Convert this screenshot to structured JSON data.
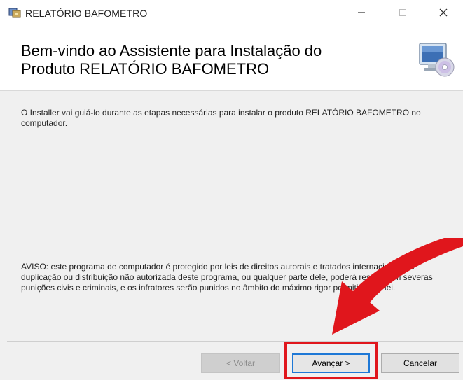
{
  "window": {
    "title": "RELATÓRIO BAFOMETRO",
    "minimize_glyph": "—",
    "maximize_glyph": "□",
    "close_glyph": "✕"
  },
  "header": {
    "title_line1": "Bem-vindo ao Assistente para Instalação do",
    "title_line2": "Produto RELATÓRIO BAFOMETRO",
    "icon": "computer-cd-icon"
  },
  "body": {
    "intro": "O Installer vai guiá-lo durante as etapas necessárias para instalar o produto RELATÓRIO BAFOMETRO no computador.",
    "warning": "AVISO: este programa de computador é protegido por leis de direitos autorais e tratados internacionais. A duplicação ou distribuição não autorizada deste programa, ou qualquer parte dele, poderá resultar em severas punições civis e criminais, e os infratores serão punidos no âmbito do máximo rigor permitido por lei."
  },
  "buttons": {
    "back": "< Voltar",
    "next": "Avançar >",
    "cancel": "Cancelar"
  },
  "annotation": {
    "arrow_color": "#e0161c",
    "highlight_color": "#e0161c"
  }
}
